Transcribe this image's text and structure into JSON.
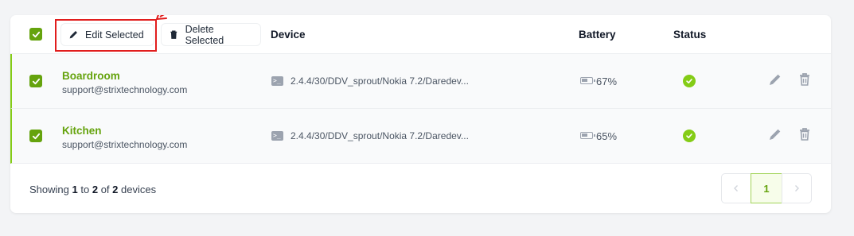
{
  "toolbar": {
    "edit_selected_label": "Edit Selected",
    "delete_selected_label": "Delete Selected"
  },
  "table": {
    "columns": {
      "device": "Device",
      "battery": "Battery",
      "status": "Status"
    },
    "rows": [
      {
        "name": "Boardroom",
        "email": "support@strixtechnology.com",
        "device": "2.4.4/30/DDV_sprout/Nokia 7.2/Daredev...",
        "battery": "67%",
        "battery_level": 0.67,
        "status": "ok",
        "checked": true
      },
      {
        "name": "Kitchen",
        "email": "support@strixtechnology.com",
        "device": "2.4.4/30/DDV_sprout/Nokia 7.2/Daredev...",
        "battery": "65%",
        "battery_level": 0.65,
        "status": "ok",
        "checked": true
      }
    ]
  },
  "footer": {
    "showing_prefix": "Showing",
    "from": "1",
    "to_word": "to",
    "to": "2",
    "of_word": "of",
    "total": "2",
    "suffix": "devices"
  },
  "pagination": {
    "current_page": "1",
    "prev_icon": "chevron-left-icon",
    "next_icon": "chevron-right-icon"
  },
  "icons": {
    "select_all": "checkbox-checked-icon",
    "edit": "pencil-icon",
    "delete": "trash-icon",
    "device": "terminal-icon",
    "battery": "battery-icon",
    "status": "check-circle-icon"
  },
  "colors": {
    "accent": "#65a30d",
    "status_ok": "#84cc16",
    "annotation": "#e11d1d"
  }
}
